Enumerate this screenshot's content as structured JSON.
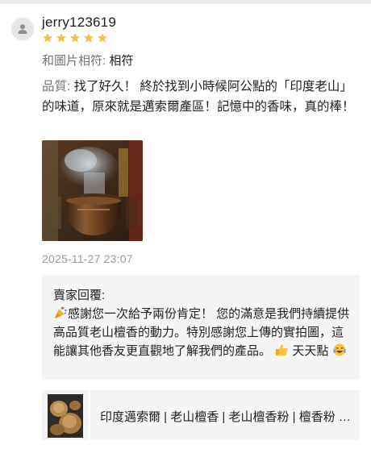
{
  "review": {
    "username": "jerry123619",
    "rating": 5,
    "rating_max": 5,
    "match_label": "和圖片相符: ",
    "match_value": "相符",
    "quality_label": "品質: ",
    "quality_text": "找了好久！ 終於找到小時候阿公點的「印度老山」的味道，原來就是邁索爾產區！記憶中的香味，真的棒！",
    "timestamp": "2025-11-27 23:07",
    "photo_icon": "incense-burner-photo"
  },
  "seller_reply": {
    "title": "賣家回覆:",
    "emoji_start": "party-popper-icon",
    "text_main": "感謝您一次給予兩份肯定！ 您的滿意是我們持續提供高品質老山檀香的動力。特別感謝您上傳的實拍圖，這能讓其他香友更直觀地了解我們的產品。",
    "emoji_mid": "thumbs-up-icon",
    "signature": " 天天點",
    "emoji_end": "tears-of-joy-icon"
  },
  "product": {
    "title": "印度邁索爾 | 老山檀香 | 老山檀香粉 | 檀香粉 | 檀香 | 老山檀",
    "thumb_icon": "sandalwood-product-thumbnail"
  },
  "colors": {
    "star": "#f6c344",
    "muted_text": "#757575",
    "timestamp": "#9a9a9a",
    "reply_bg": "#f5f5f5"
  }
}
